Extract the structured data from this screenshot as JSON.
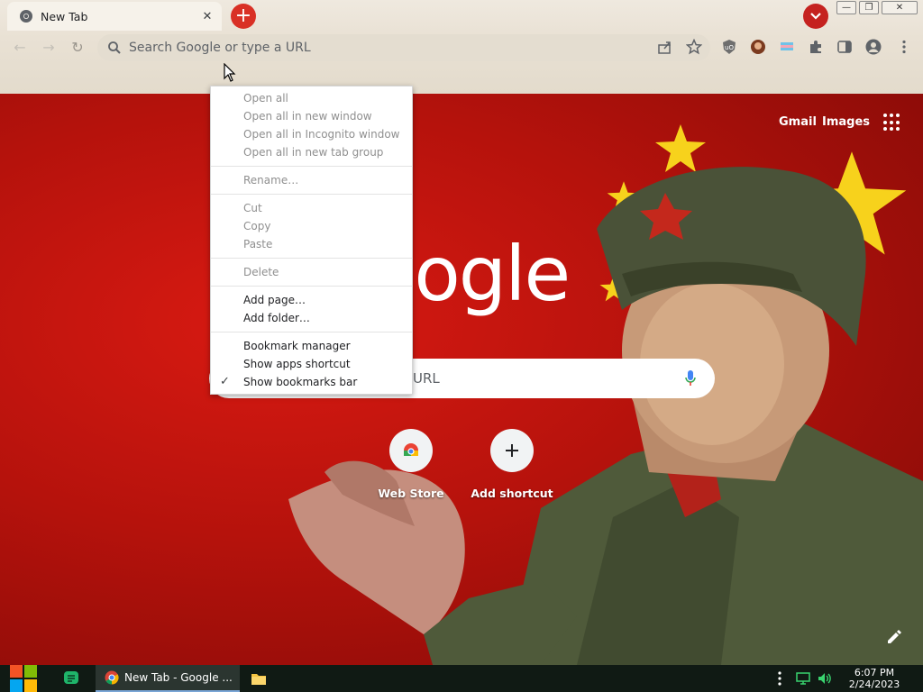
{
  "browser": {
    "tab": {
      "title": "New Tab"
    },
    "omnibox": {
      "placeholder": "Search Google or type a URL"
    }
  },
  "page": {
    "top_links": {
      "gmail": "Gmail",
      "images": "Images"
    },
    "logo": "oogle",
    "searchbox": {
      "visible_text": "URL"
    },
    "shortcuts": [
      {
        "label": "Web Store"
      },
      {
        "label": "Add shortcut"
      }
    ]
  },
  "context_menu": {
    "items": [
      {
        "label": "Open all",
        "enabled": false
      },
      {
        "label": "Open all in new window",
        "enabled": false
      },
      {
        "label": "Open all in Incognito window",
        "enabled": false
      },
      {
        "label": "Open all in new tab group",
        "enabled": false
      },
      {
        "label": "Rename…",
        "enabled": false
      },
      {
        "label": "Cut",
        "enabled": false
      },
      {
        "label": "Copy",
        "enabled": false
      },
      {
        "label": "Paste",
        "enabled": false
      },
      {
        "label": "Delete",
        "enabled": false
      },
      {
        "label": "Add page…",
        "enabled": true
      },
      {
        "label": "Add folder…",
        "enabled": true
      },
      {
        "label": "Bookmark manager",
        "enabled": true
      },
      {
        "label": "Show apps shortcut",
        "enabled": true
      },
      {
        "label": "Show bookmarks bar",
        "enabled": true,
        "checked": true
      }
    ]
  },
  "taskbar": {
    "chrome_task_label": "New Tab - Google ...",
    "clock": {
      "time": "6:07 PM",
      "date": "2/24/2023"
    }
  },
  "colors": {
    "page_background": "#b5120c",
    "newtab_button": "#d93025",
    "taskbar": "#101a14"
  }
}
